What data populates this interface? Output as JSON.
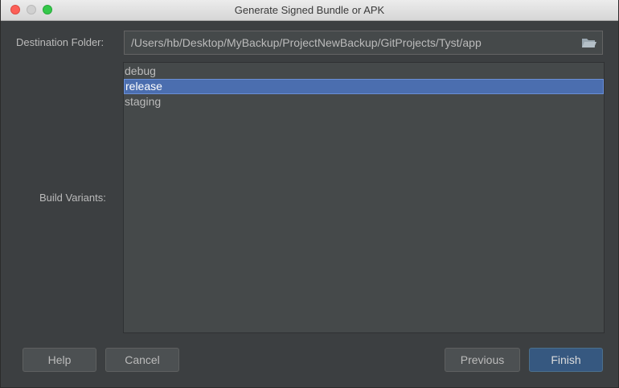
{
  "window": {
    "title": "Generate Signed Bundle or APK"
  },
  "destination": {
    "label": "Destination Folder:",
    "value": "/Users/hb/Desktop/MyBackup/ProjectNewBackup/GitProjects/Tyst/app",
    "browse_icon": "folder-icon"
  },
  "build_variants": {
    "label": "Build Variants:",
    "items": [
      {
        "label": "debug",
        "selected": false
      },
      {
        "label": "release",
        "selected": true
      },
      {
        "label": "staging",
        "selected": false
      }
    ]
  },
  "buttons": {
    "help": "Help",
    "cancel": "Cancel",
    "previous": "Previous",
    "finish": "Finish"
  },
  "colors": {
    "background": "#3c3f41",
    "field": "#45494a",
    "selection": "#4b6eaf",
    "default_button": "#365880"
  }
}
